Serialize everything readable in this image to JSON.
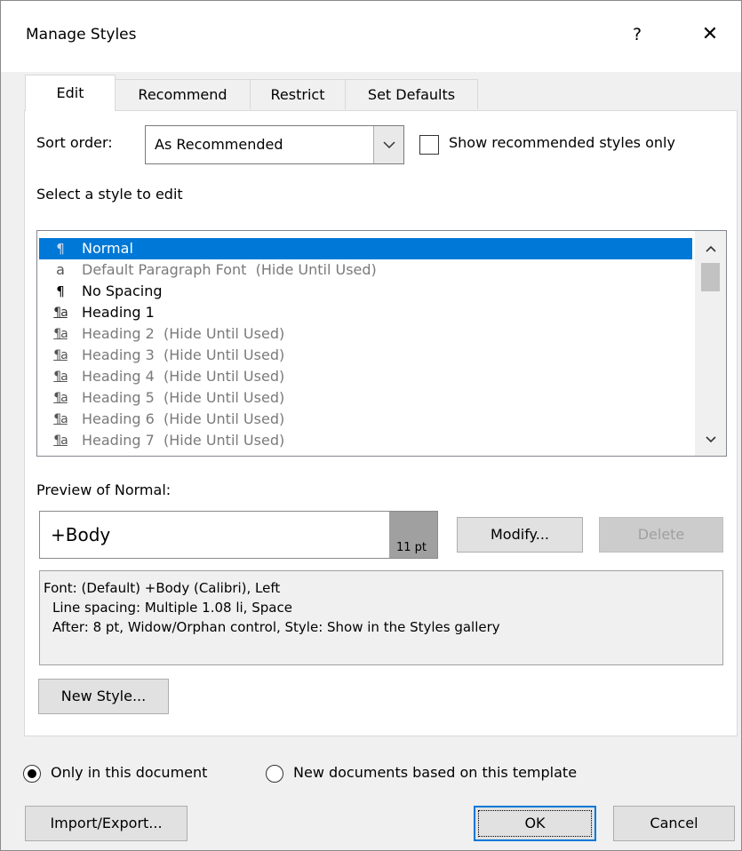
{
  "dialog": {
    "title": "Manage Styles",
    "help_label": "?",
    "close_label": "✕"
  },
  "tabs": [
    {
      "label": "Edit",
      "accel": "E"
    },
    {
      "label": "Recommend",
      "accel": "R"
    },
    {
      "label": "Restrict",
      "accel": "s"
    },
    {
      "label": "Set Defaults",
      "accel": "f"
    }
  ],
  "sort": {
    "label": "Sort order:",
    "value": "As Recommended",
    "show_recommended_label": "Show recommended styles only",
    "show_recommended_checked": false
  },
  "list": {
    "heading": "Select a style to edit",
    "items": [
      {
        "icon": "paragraph",
        "name": "Normal",
        "suffix": "",
        "selected": true,
        "hidden": false
      },
      {
        "icon": "character",
        "name": "Default Paragraph Font",
        "suffix": "(Hide Until Used)",
        "selected": false,
        "hidden": true
      },
      {
        "icon": "paragraph",
        "name": "No Spacing",
        "suffix": "",
        "selected": false,
        "hidden": false
      },
      {
        "icon": "linked",
        "name": "Heading 1",
        "suffix": "",
        "selected": false,
        "hidden": false
      },
      {
        "icon": "linked",
        "name": "Heading 2",
        "suffix": "(Hide Until Used)",
        "selected": false,
        "hidden": true
      },
      {
        "icon": "linked",
        "name": "Heading 3",
        "suffix": "(Hide Until Used)",
        "selected": false,
        "hidden": true
      },
      {
        "icon": "linked",
        "name": "Heading 4",
        "suffix": "(Hide Until Used)",
        "selected": false,
        "hidden": true
      },
      {
        "icon": "linked",
        "name": "Heading 5",
        "suffix": "(Hide Until Used)",
        "selected": false,
        "hidden": true
      },
      {
        "icon": "linked",
        "name": "Heading 6",
        "suffix": "(Hide Until Used)",
        "selected": false,
        "hidden": true
      },
      {
        "icon": "linked",
        "name": "Heading 7",
        "suffix": "(Hide Until Used)",
        "selected": false,
        "hidden": true
      }
    ]
  },
  "preview": {
    "label": "Preview of Normal:",
    "font_text": "+Body",
    "size_text": "11 pt",
    "modify_label": "Modify...",
    "delete_label": "Delete"
  },
  "description": {
    "line1": "Font: (Default) +Body (Calibri), Left",
    "line2": "Line spacing:  Multiple 1.08 li, Space",
    "line3": "After:  8 pt, Widow/Orphan control, Style: Show in the Styles gallery"
  },
  "new_style_label": "New Style...",
  "scope": {
    "only_doc_label": "Only in this document",
    "new_docs_label": "New documents based on this template",
    "selected": "only_doc"
  },
  "footer": {
    "import_export_label": "Import/Export...",
    "ok_label": "OK",
    "cancel_label": "Cancel"
  }
}
